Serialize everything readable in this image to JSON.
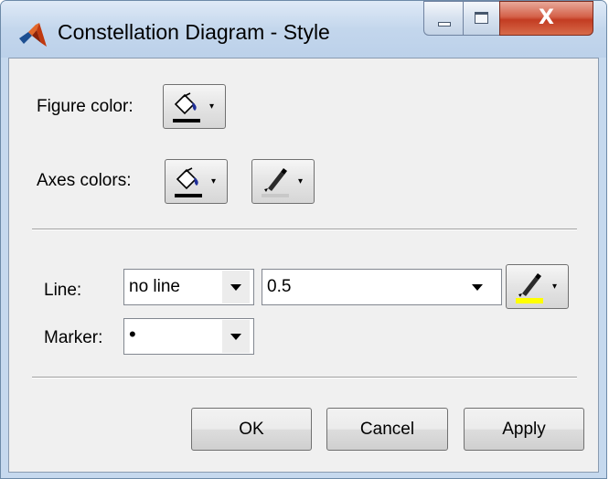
{
  "window": {
    "title": "Constellation Diagram - Style",
    "app_icon": "matlab-membrane-icon",
    "controls": {
      "minimize_icon": "minimize-icon",
      "maximize_icon": "maximize-icon",
      "close_icon": "close-icon",
      "close_glyph": "X"
    }
  },
  "figure": {
    "label": "Figure color:",
    "fill_icon": "paint-bucket-icon",
    "fill_color": "#000000"
  },
  "axes": {
    "label": "Axes colors:",
    "fill_icon": "paint-bucket-icon",
    "fill_color": "#000000",
    "line_icon": "pen-icon",
    "line_color": "#c8c8c8"
  },
  "line": {
    "label": "Line:",
    "style_value": "no line",
    "width_value": "0.5",
    "color_icon": "pen-icon",
    "color": "#ffff00"
  },
  "marker": {
    "label": "Marker:",
    "value": "•"
  },
  "buttons": {
    "ok": "OK",
    "cancel": "Cancel",
    "apply": "Apply"
  },
  "colors": {
    "titlebar": "#c6d9ee",
    "close_button": "#c94a2f",
    "dialog_background": "#f0f0f0"
  }
}
